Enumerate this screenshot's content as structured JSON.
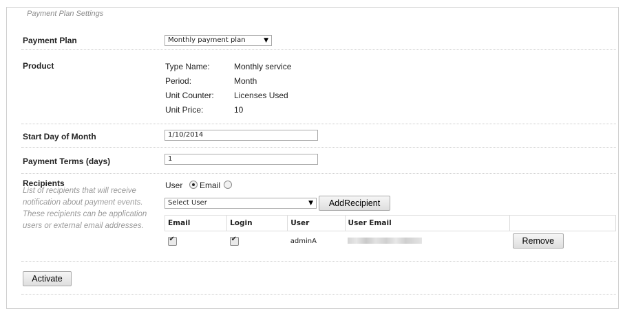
{
  "legend": "Payment Plan Settings",
  "payment_plan": {
    "label": "Payment Plan",
    "selected": "Monthly payment plan"
  },
  "product": {
    "label": "Product",
    "fields": [
      {
        "key": "Type Name:",
        "value": "Monthly service"
      },
      {
        "key": "Period:",
        "value": "Month"
      },
      {
        "key": "Unit Counter:",
        "value": "Licenses Used"
      },
      {
        "key": "Unit Price:",
        "value": "10"
      }
    ]
  },
  "start_day": {
    "label": "Start Day of Month",
    "value": "1/10/2014"
  },
  "payment_terms": {
    "label": "Payment Terms (days)",
    "value": "1"
  },
  "recipients": {
    "label": "Recipients",
    "description": "List of recipients that will receive notification about payment events. These recipients can be application users or external email addresses.",
    "radio_user": "User",
    "radio_email": "Email",
    "select_user": "Select User",
    "add_button": "AddRecipient",
    "columns": [
      "Email",
      "Login",
      "User",
      "User Email"
    ],
    "rows": [
      {
        "email": true,
        "login": true,
        "user": "adminA",
        "remove": "Remove"
      }
    ]
  },
  "activate_button": "Activate"
}
